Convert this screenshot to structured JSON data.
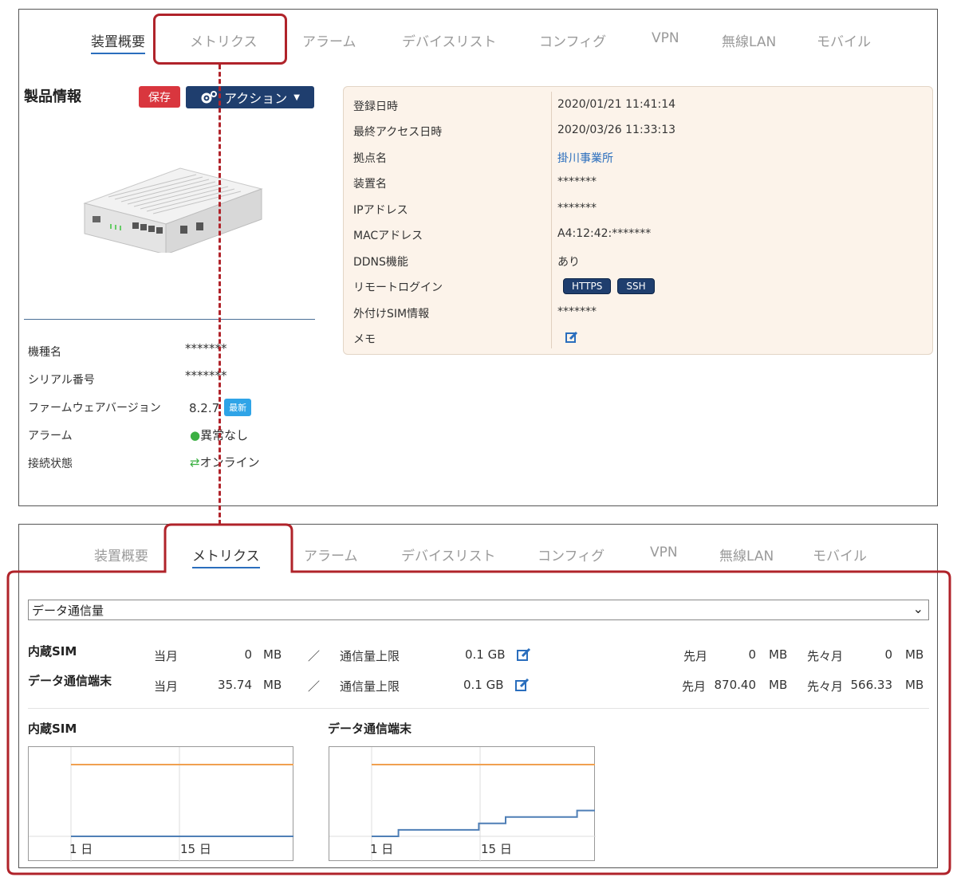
{
  "top": {
    "tabs": [
      {
        "label": "装置概要",
        "active": true
      },
      {
        "label": "メトリクス",
        "active": false
      },
      {
        "label": "アラーム",
        "active": false
      },
      {
        "label": "デバイスリスト",
        "active": false
      },
      {
        "label": "コンフィグ",
        "active": false
      },
      {
        "label": "VPN",
        "active": false
      },
      {
        "label": "無線LAN",
        "active": false
      },
      {
        "label": "モバイル",
        "active": false
      }
    ],
    "section_title": "製品情報",
    "save_label": "保存",
    "action_label": "アクション",
    "specs": [
      {
        "label": "機種名",
        "value": "*******"
      },
      {
        "label": "シリアル番号",
        "value": "*******"
      },
      {
        "label": "ファームウェアバージョン",
        "value": "8.2.7",
        "badge": "最新"
      },
      {
        "label": "アラーム",
        "value": "異常なし"
      },
      {
        "label": "接続状態",
        "value": "オンライン"
      }
    ],
    "info": [
      {
        "label": "登録日時",
        "value": "2020/01/21 11:41:14"
      },
      {
        "label": "最終アクセス日時",
        "value": "2020/03/26 11:33:13"
      },
      {
        "label": "拠点名",
        "value": "掛川事業所"
      },
      {
        "label": "装置名",
        "value": "*******"
      },
      {
        "label": "IPアドレス",
        "value": "*******"
      },
      {
        "label": "MACアドレス",
        "value": "A4:12:42:*******"
      },
      {
        "label": "DDNS機能",
        "value": "あり"
      },
      {
        "label": "リモートログイン",
        "pills": [
          "HTTPS",
          "SSH"
        ]
      },
      {
        "label": "外付けSIM情報",
        "value": "*******"
      },
      {
        "label": "メモ",
        "value": ""
      }
    ],
    "colors": {
      "accent": "#1f3e6e",
      "danger": "#d9363e",
      "info_bg": "#fcf3ea",
      "link": "#2a6ebd",
      "ok": "#3cb043"
    }
  },
  "bottom": {
    "tabs": [
      {
        "label": "装置概要",
        "active": false
      },
      {
        "label": "メトリクス",
        "active": true
      },
      {
        "label": "アラーム",
        "active": false
      },
      {
        "label": "デバイスリスト",
        "active": false
      },
      {
        "label": "コンフィグ",
        "active": false
      },
      {
        "label": "VPN",
        "active": false
      },
      {
        "label": "無線LAN",
        "active": false
      },
      {
        "label": "モバイル",
        "active": false
      }
    ],
    "select_value": "データ通信量",
    "usage": [
      {
        "name": "内蔵SIM",
        "current_label": "当月",
        "current": "0",
        "unit": "MB",
        "slash": "／",
        "limit_label": "通信量上限",
        "limit": "0.1 GB",
        "prev_label": "先月",
        "prev": "0",
        "prev_unit": "MB",
        "prev2_label": "先々月",
        "prev2": "0",
        "prev2_unit": "MB"
      },
      {
        "name": "データ通信端末",
        "current_label": "当月",
        "current": "35.74",
        "unit": "MB",
        "slash": "／",
        "limit_label": "通信量上限",
        "limit": "0.1 GB",
        "prev_label": "先月",
        "prev": "870.40",
        "prev_unit": "MB",
        "prev2_label": "先々月",
        "prev2": "566.33",
        "prev2_unit": "MB"
      }
    ],
    "charts": [
      {
        "title": "内蔵SIM",
        "x_ticks": [
          "1 日",
          "15 日"
        ]
      },
      {
        "title": "データ通信端末",
        "x_ticks": [
          "1 日",
          "15 日"
        ]
      }
    ]
  },
  "chart_data": [
    {
      "type": "line",
      "title": "内蔵SIM",
      "x_ticks": [
        "1 日",
        "15 日"
      ],
      "series": [
        {
          "values": [
            100,
            100,
            100,
            100,
            100,
            100,
            100,
            100,
            100,
            100,
            100,
            100,
            100,
            100,
            100,
            100,
            100,
            100,
            100,
            100,
            100,
            100,
            100,
            100,
            100,
            100
          ],
          "color": "#f0a050"
        },
        {
          "values": [
            0,
            0,
            0,
            0,
            0,
            0,
            0,
            0,
            0,
            0,
            0,
            0,
            0,
            0,
            0,
            0,
            0,
            0,
            0,
            0,
            0,
            0,
            0,
            0,
            0,
            0
          ],
          "color": "#4f7fb6"
        }
      ]
    },
    {
      "type": "line",
      "title": "データ通信端末",
      "x_ticks": [
        "1 日",
        "15 日"
      ],
      "series": [
        {
          "values": [
            100,
            100,
            100,
            100,
            100,
            100,
            100,
            100,
            100,
            100,
            100,
            100,
            100,
            100,
            100,
            100,
            100,
            100,
            100,
            100,
            100,
            100,
            100,
            100,
            100,
            100
          ],
          "color": "#f0a050"
        },
        {
          "values": [
            0,
            0,
            0,
            9,
            9,
            9,
            9,
            9,
            9,
            9,
            9,
            9,
            18,
            18,
            18,
            27,
            27,
            27,
            27,
            27,
            27,
            27,
            27,
            36,
            36,
            36
          ],
          "color": "#4f7fb6",
          "step": true
        }
      ]
    }
  ]
}
